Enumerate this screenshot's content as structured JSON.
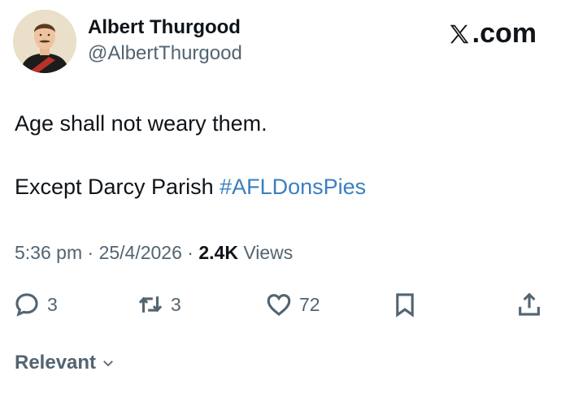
{
  "author": {
    "display_name": "Albert Thurgood",
    "handle": "@AlbertThurgood"
  },
  "brand": {
    "site": ".com"
  },
  "tweet": {
    "line1": "Age shall not weary them.",
    "line2_text": "Except Darcy Parish ",
    "hashtag": "#AFLDonsPies"
  },
  "meta": {
    "time": "5:36 pm",
    "sep1": " · ",
    "date": "25/4/2026",
    "sep2": " · ",
    "views_count": "2.4K",
    "views_label": " Views"
  },
  "actions": {
    "replies": "3",
    "reposts": "3",
    "likes": "72"
  },
  "sort": {
    "label": "Relevant"
  },
  "colors": {
    "hashtag": "#3a7fc0",
    "muted": "#536471",
    "text": "#0f1419"
  }
}
